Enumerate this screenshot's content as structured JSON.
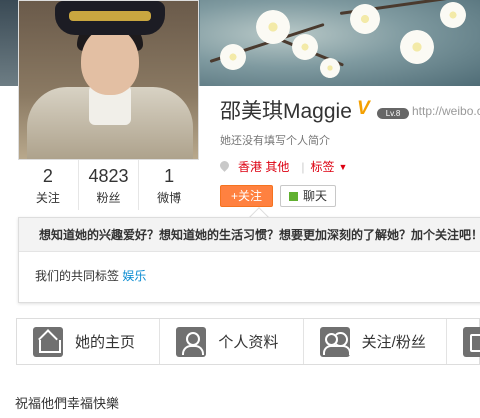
{
  "profile": {
    "name": "邵美琪Maggie",
    "verified_mark": "V",
    "level_badge": "Lv.8",
    "url": "http://weibo.c",
    "intro": "她还没有填写个人简介",
    "location": "香港 其他",
    "tags_label": "标签",
    "tags_caret": "▼"
  },
  "stats": [
    {
      "num": "2",
      "label": "关注"
    },
    {
      "num": "4823",
      "label": "粉丝"
    },
    {
      "num": "1",
      "label": "微博"
    }
  ],
  "actions": {
    "follow_label": "+关注",
    "chat_label": "聊天"
  },
  "popup": {
    "heading": "想知道她的兴趣爱好？想知道她的生活习惯？想要更加深刻的了解她？加个关注吧！",
    "common_tags_label": "我们的共同标签",
    "common_tag": "娱乐"
  },
  "tabs": [
    {
      "label": "她的主页",
      "icon": "home-icon"
    },
    {
      "label": "个人资料",
      "icon": "person-icon"
    },
    {
      "label": "关注/粉丝",
      "icon": "people-icon"
    },
    {
      "label": "",
      "icon": "album-icon"
    }
  ],
  "post": {
    "text": "祝福他們幸福快樂"
  },
  "colors": {
    "follow_button": "#ff8140",
    "link": "#0a8cd2",
    "accent_red": "#dd0011",
    "verified": "#f4a000"
  }
}
